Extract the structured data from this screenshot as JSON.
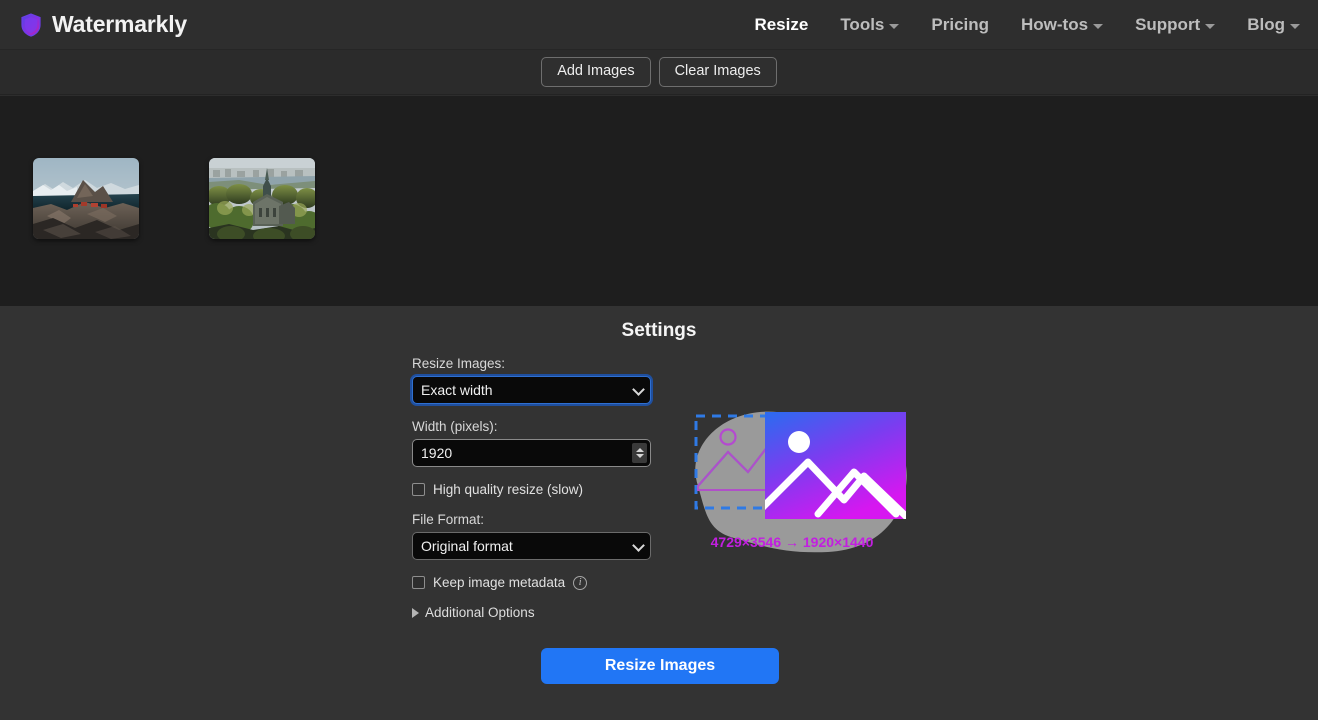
{
  "header": {
    "brand": "Watermarkly",
    "brand_icon": "shield-icon",
    "nav": [
      {
        "label": "Resize",
        "active": true,
        "caret": false
      },
      {
        "label": "Tools",
        "active": false,
        "caret": true
      },
      {
        "label": "Pricing",
        "active": false,
        "caret": false
      },
      {
        "label": "How-tos",
        "active": false,
        "caret": true
      },
      {
        "label": "Support",
        "active": false,
        "caret": true
      },
      {
        "label": "Blog",
        "active": false,
        "caret": true
      }
    ]
  },
  "toolbar": {
    "add_images": "Add Images",
    "clear_images": "Clear Images"
  },
  "image_strip": {
    "thumbnails": [
      {
        "alt": "Norwegian fjord village with rocky mountain"
      },
      {
        "alt": "Aerial view of city with cathedral and autumn trees"
      }
    ]
  },
  "settings": {
    "title": "Settings",
    "resize_label": "Resize Images:",
    "resize_value": "Exact width",
    "width_label": "Width (pixels):",
    "width_value": "1920",
    "high_quality_label": "High quality resize (slow)",
    "high_quality_checked": false,
    "format_label": "File Format:",
    "format_value": "Original format",
    "metadata_label": "Keep image metadata",
    "metadata_checked": false,
    "additional_options": "Additional Options",
    "submit_label": "Resize Images"
  },
  "illustration": {
    "dimensions_text": "4729×3546 → 1920×1440",
    "text_color": "#c21fe0",
    "blob_color": "#9a9a9a",
    "gradient_from": "#2a6cf0",
    "gradient_to": "#d617f0",
    "dashed_color": "#2f7ae5"
  }
}
